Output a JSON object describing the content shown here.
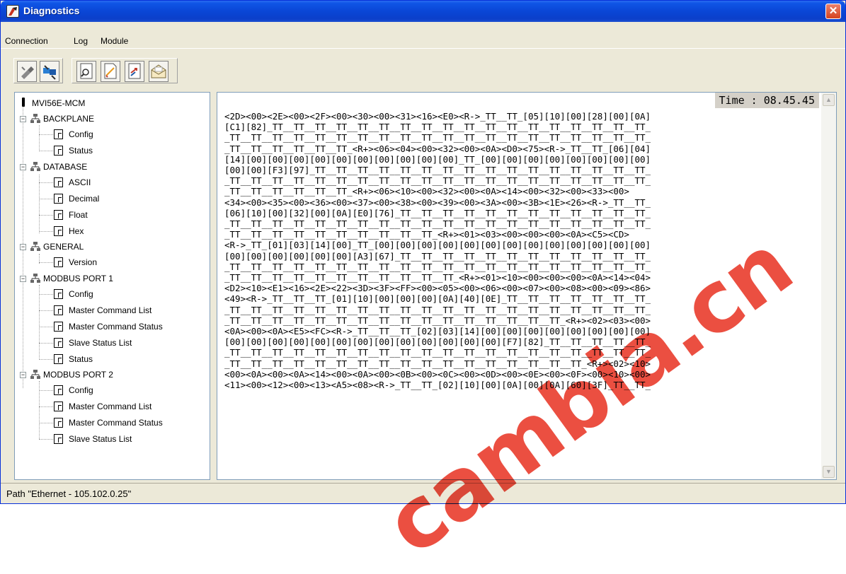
{
  "window": {
    "title": "Diagnostics",
    "close_label": "✕"
  },
  "menu": {
    "items": [
      "Connection",
      "Log",
      "Module"
    ]
  },
  "toolbar": {
    "icons": [
      "disconnect-icon",
      "connect-icon",
      "find-icon",
      "new-log-icon",
      "export-icon",
      "send-mail-icon"
    ]
  },
  "tree": {
    "root": "MVI56E-MCM",
    "nodes": [
      {
        "label": "BACKPLANE",
        "children": [
          "Config",
          "Status"
        ]
      },
      {
        "label": "DATABASE",
        "children": [
          "ASCII",
          "Decimal",
          "Float",
          "Hex"
        ]
      },
      {
        "label": "GENERAL",
        "children": [
          "Version"
        ]
      },
      {
        "label": "MODBUS PORT 1",
        "children": [
          "Config",
          "Master Command List",
          "Master Command Status",
          "Slave Status List",
          "Status"
        ]
      },
      {
        "label": "MODBUS PORT 2",
        "children": [
          "Config",
          "Master Command List",
          "Master Command Status",
          "Slave Status List"
        ]
      }
    ]
  },
  "log": {
    "time": "Time : 08.45.45",
    "lines": [
      "<2D><00><2E><00><2F><00><30><00><31><16><E0><R->_TT__TT_[05][10][00][28][00][0A]",
      "[C1][82]_TT__TT__TT__TT__TT__TT__TT__TT__TT__TT__TT__TT__TT__TT__TT__TT__TT__TT_",
      "_TT__TT__TT__TT__TT__TT__TT__TT__TT__TT__TT__TT__TT__TT__TT__TT__TT__TT__TT__TT_",
      "_TT__TT__TT__TT__TT__TT_<R+><06><04><00><32><00><0A><D0><75><R->_TT__TT_[06][04]",
      "[14][00][00][00][00][00][00][00][00][00][00]_TT_[00][00][00][00][00][00][00][00]",
      "[00][00][F3][97]_TT__TT__TT__TT__TT__TT__TT__TT__TT__TT__TT__TT__TT__TT__TT__TT_",
      "_TT__TT__TT__TT__TT__TT__TT__TT__TT__TT__TT__TT__TT__TT__TT__TT__TT__TT__TT__TT_",
      "_TT__TT__TT__TT__TT__TT_<R+><06><10><00><32><00><0A><14><00><32><00><33><00>",
      "<34><00><35><00><36><00><37><00><38><00><39><00><3A><00><3B><1E><26><R->_TT__TT_",
      "[06][10][00][32][00][0A][E0][76]_TT__TT__TT__TT__TT__TT__TT__TT__TT__TT__TT__TT_",
      "_TT__TT__TT__TT__TT__TT__TT__TT__TT__TT__TT__TT__TT__TT__TT__TT__TT__TT__TT__TT_",
      "_TT__TT__TT__TT__TT__TT__TT__TT__TT__TT_<R+><01><03><00><00><00><0A><C5><CD>",
      "<R->_TT_[01][03][14][00]_TT_[00][00][00][00][00][00][00][00][00][00][00][00][00]",
      "[00][00][00][00][00][00][A3][67]_TT__TT__TT__TT__TT__TT__TT__TT__TT__TT__TT__TT_",
      "_TT__TT__TT__TT__TT__TT__TT__TT__TT__TT__TT__TT__TT__TT__TT__TT__TT__TT__TT__TT_",
      "_TT__TT__TT__TT__TT__TT__TT__TT__TT__TT__TT_<R+><01><10><00><00><00><0A><14><04>",
      "<D2><10><E1><16><2E><22><3D><3F><FF><00><05><00><06><00><07><00><08><00><09><86>",
      "<49><R->_TT__TT__TT_[01][10][00][00][00][0A][40][0E]_TT__TT__TT__TT__TT__TT__TT_",
      "_TT__TT__TT__TT__TT__TT__TT__TT__TT__TT__TT__TT__TT__TT__TT__TT__TT__TT__TT__TT_",
      "_TT__TT__TT__TT__TT__TT__TT__TT__TT__TT__TT__TT__TT__TT__TT__TT_<R+><02><03><00>",
      "<0A><00><0A><E5><FC><R->_TT__TT__TT_[02][03][14][00][00][00][00][00][00][00][00]",
      "[00][00][00][00][00][00][00][00][00][00][00][00][00][F7][82]_TT__TT__TT__TT__TT_",
      "_TT__TT__TT__TT__TT__TT__TT__TT__TT__TT__TT__TT__TT__TT__TT__TT__TT__TT__TT__TT_",
      "_TT__TT__TT__TT__TT__TT__TT__TT__TT__TT__TT__TT__TT__TT__TT__TT__TT_<R+><02><10>",
      "<00><0A><00><0A><14><00><0A><00><0B><00><0C><00><0D><00><0E><00><0F><00><10><00>",
      "<11><00><12><00><13><A5><08><R->_TT__TT_[02][10][00][0A][00][0A][60][3F]_TT__TT_"
    ]
  },
  "status": {
    "path": "Path \"Ethernet - 105.102.0.25\""
  },
  "watermark": "cambia.cn"
}
